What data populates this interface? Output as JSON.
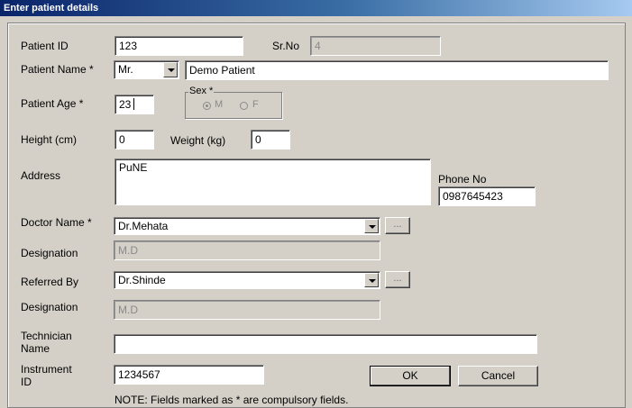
{
  "window": {
    "title": "Enter patient details"
  },
  "fields": {
    "patient_id": {
      "label": "Patient ID",
      "value": "123"
    },
    "sr_no": {
      "label": "Sr.No",
      "value": "4"
    },
    "patient_name": {
      "label": "Patient Name *",
      "title": "Mr.",
      "value": "Demo Patient"
    },
    "patient_age": {
      "label": "Patient Age *",
      "value": "23"
    },
    "sex": {
      "legend": "Sex *",
      "options": [
        "M",
        "F"
      ],
      "selected": "M"
    },
    "height": {
      "label": "Height (cm)",
      "value": "0"
    },
    "weight": {
      "label": "Weight  (kg)",
      "value": "0"
    },
    "address": {
      "label": "Address",
      "value": "PuNE"
    },
    "phone": {
      "label": "Phone No",
      "value": "0987645423"
    },
    "doctor_name": {
      "label": "Doctor Name *",
      "value": "Dr.Mehata",
      "browse_label": "..."
    },
    "doctor_designation": {
      "label": "Designation",
      "value": "M.D"
    },
    "referred_by": {
      "label": "Referred By",
      "value": "Dr.Shinde",
      "browse_label": "..."
    },
    "referred_designation": {
      "label": "Designation",
      "value": "M.D"
    },
    "technician_name": {
      "label_line1": "Technician",
      "label_line2": "Name",
      "value": ""
    },
    "instrument_id": {
      "label_line1": "Instrument",
      "label_line2": "ID",
      "value": "1234567"
    }
  },
  "buttons": {
    "ok": "OK",
    "cancel": "Cancel"
  },
  "note": "NOTE: Fields marked as * are compulsory fields."
}
